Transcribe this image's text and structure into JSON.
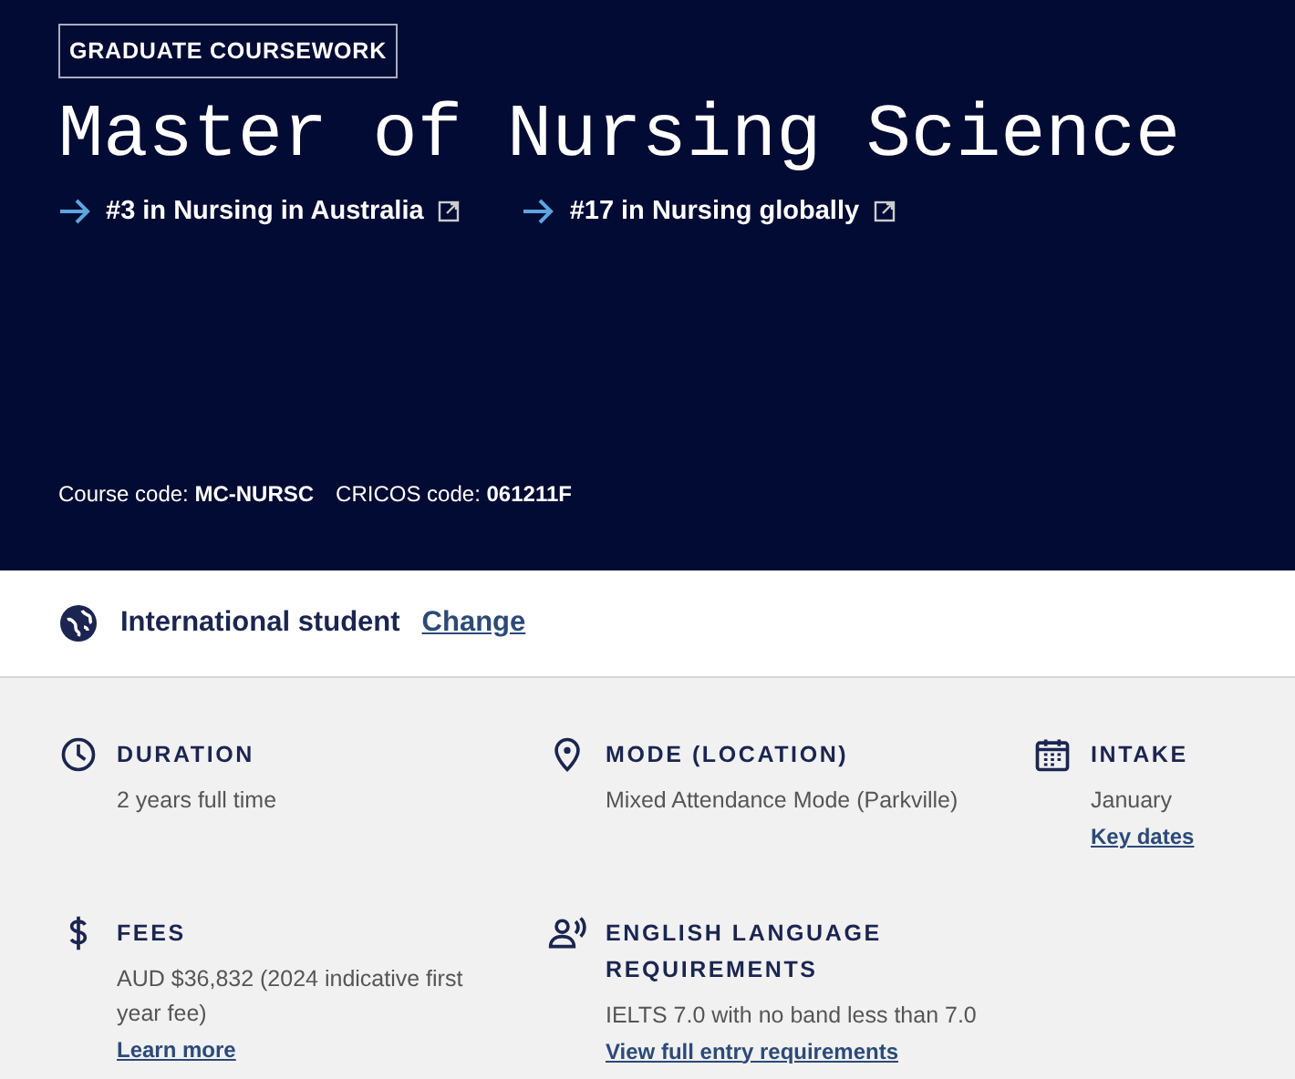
{
  "header": {
    "badge": "GRADUATE COURSEWORK",
    "title": "Master of Nursing Science",
    "rankings": [
      {
        "text": "#3 in Nursing in Australia"
      },
      {
        "text": "#17 in Nursing globally"
      }
    ],
    "codes": [
      "Course code: **MC-NURSC**",
      "CRICOS code: **061211F**"
    ]
  },
  "student": {
    "label": "International student",
    "link": "Change"
  },
  "facts": [
    {
      "kind": "clock",
      "title": "DURATION",
      "text": "2 years full time"
    },
    {
      "kind": "pin",
      "title": "MODE (LOCATION)",
      "text": "Mixed Attendance Mode (Parkville)"
    },
    {
      "kind": "calendar",
      "title": "INTAKE",
      "text": "January",
      "link": "Key dates"
    },
    {
      "kind": "dollar",
      "title": "FEES",
      "text": "AUD $36,832 (2024 indicative first year fee)",
      "link": "Learn more"
    },
    {
      "kind": "speech",
      "title": "ENGLISH LANGUAGE REQUIREMENTS",
      "text": "IELTS 7.0 with no band less than 7.0",
      "link": "View full entry requirements"
    }
  ]
}
